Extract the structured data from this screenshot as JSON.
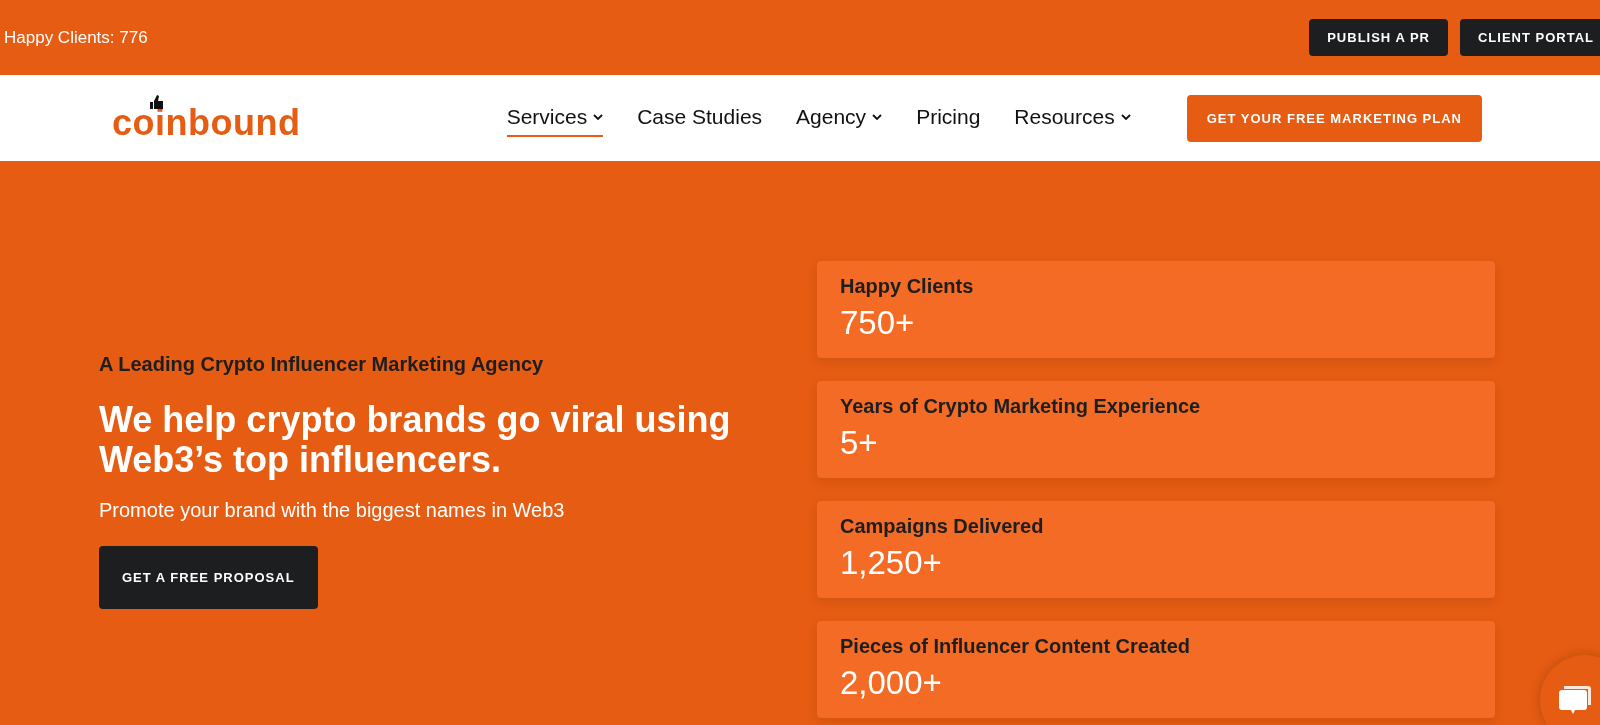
{
  "top_bar": {
    "counter": "Happy Clients: 776",
    "buttons": [
      "PUBLISH A PR",
      "CLIENT PORTAL"
    ]
  },
  "nav": {
    "logo": "coinbound",
    "items": [
      {
        "label": "Services",
        "selected": true,
        "dropdown": true
      },
      {
        "label": "Case Studies",
        "selected": false,
        "dropdown": false
      },
      {
        "label": "Agency",
        "selected": false,
        "dropdown": true
      },
      {
        "label": "Pricing",
        "selected": false,
        "dropdown": false
      },
      {
        "label": "Resources",
        "selected": false,
        "dropdown": true
      }
    ],
    "cta": "GET YOUR FREE MARKETING PLAN"
  },
  "hero": {
    "eyebrow": "A Leading Crypto Influencer Marketing Agency",
    "headline": "We help crypto brands go viral using Web3’s top influencers.",
    "subtitle": "Promote your brand with the biggest names in Web3",
    "button": "GET A FREE PROPOSAL"
  },
  "stats": [
    {
      "label": "Happy Clients",
      "value": "750+"
    },
    {
      "label": "Years of Crypto Marketing Experience",
      "value": "5+"
    },
    {
      "label": "Campaigns Delivered",
      "value": "1,250+"
    },
    {
      "label": "Pieces of Influencer Content Created",
      "value": "2,000+"
    }
  ]
}
